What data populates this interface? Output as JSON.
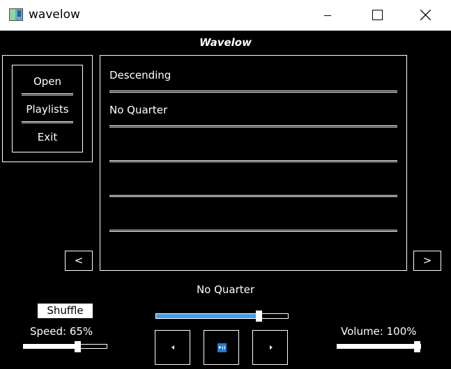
{
  "window": {
    "title": "wavelow"
  },
  "header": {
    "title": "Wavelow"
  },
  "menu": {
    "items": [
      {
        "label": "Open"
      },
      {
        "label": "Playlists"
      },
      {
        "label": "Exit"
      }
    ]
  },
  "tracks": [
    {
      "title": "Descending"
    },
    {
      "title": "No Quarter"
    },
    {
      "title": ""
    },
    {
      "title": ""
    },
    {
      "title": ""
    }
  ],
  "pager": {
    "prev_label": "<",
    "next_label": ">"
  },
  "now_playing": "No Quarter",
  "shuffle_label": "Shuffle",
  "speed": {
    "label": "Speed: 65%",
    "value": 0.65
  },
  "volume": {
    "label": "Volume: 100%",
    "value": 1.0
  },
  "progress": {
    "value": 0.78
  },
  "colors": {
    "background": "#000000",
    "foreground": "#ffffff",
    "progress_fill": "#4a9ae8",
    "play_accent": "#1e7ad6"
  },
  "icons": {
    "prev": "prev-track-icon",
    "play": "play-pause-icon",
    "next": "next-track-icon"
  }
}
